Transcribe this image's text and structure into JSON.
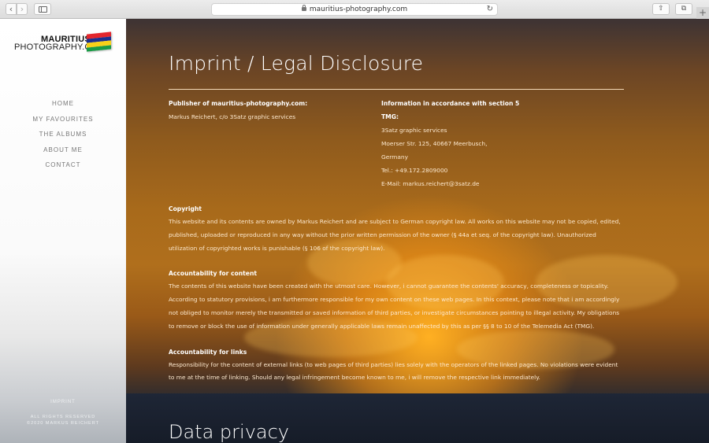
{
  "browser": {
    "url": "mauritius-photography.com",
    "back_glyph": "‹",
    "forward_glyph": "›",
    "reload_glyph": "↻",
    "share_glyph": "⇧",
    "tabs_glyph": "⧉",
    "newtab_glyph": "+"
  },
  "sidebar": {
    "logo": {
      "line1": "MAURITIUS",
      "line2": "PHOTOGRAPHY.COM",
      "flag_colors": [
        "#e3262d",
        "#1b2f8f",
        "#f7d019",
        "#1a9b46"
      ]
    },
    "menu": [
      {
        "label": "HOME"
      },
      {
        "label": "MY FAVOURITES"
      },
      {
        "label": "THE ALBUMS"
      },
      {
        "label": "ABOUT ME"
      },
      {
        "label": "CONTACT"
      }
    ],
    "footer": {
      "imprint": "IMPRINT",
      "rights_line1": "ALL RIGHTS RESERVED",
      "rights_line2": "©2020 MARKUS REICHERT"
    }
  },
  "main": {
    "title": "Imprint / Legal Disclosure",
    "publisher": {
      "heading": "Publisher of mauritius-photography.com:",
      "text": "Markus Reichert, c/o 3Satz graphic services"
    },
    "info": {
      "heading_line1": "Information in accordance with section 5",
      "heading_line2": "TMG:",
      "lines": [
        "3Satz graphic services",
        "Moerser Str. 125, 40667 Meerbusch,",
        "Germany",
        "Tel.: +49.172.2809000",
        "E-Mail: markus.reichert@3satz.de"
      ]
    },
    "sections": [
      {
        "heading": "Copyright",
        "text": "This website and its contents are owned by Markus Reichert and are subject to German copyright law. All works on this website may not be copied, edited, published, uploaded or reproduced in any way without the prior written permission of the owner (§ 44a et seq. of the copyright law). Unauthorized utilization of copyrighted works is punishable (§ 106 of the copyright law)."
      },
      {
        "heading": "Accountability for content",
        "text": "The contents of this website have been created with the utmost care. However, i cannot guarantee the contents' accuracy, completeness or topicality. According to statutory provisions, i am furthermore responsible for my own content on these web pages. In this context, please note that i am accordingly not obliged to monitor merely the transmitted or saved information of third parties, or investigate circumstances pointing to illegal activity. My obligations to remove or block the use of information under generally applicable laws remain unaffected by this as per §§ 8 to 10 of the Telemedia Act (TMG)."
      },
      {
        "heading": "Accountability for links",
        "text": "Responsibility for the content of external links (to web pages of third parties) lies solely with the operators of the linked pages. No violations were evident to me at the time of linking. Should any legal infringement become known to me, i will remove the respective link immediately."
      }
    ],
    "next_title": "Data privacy"
  }
}
